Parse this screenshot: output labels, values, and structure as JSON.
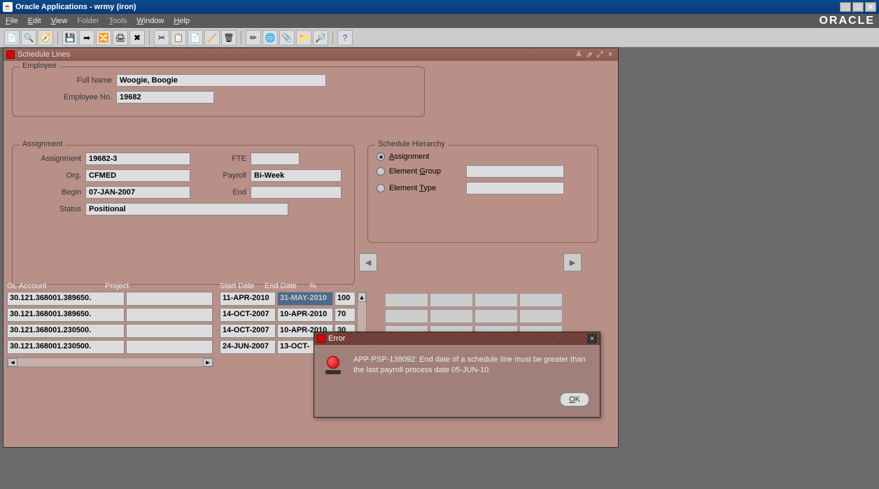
{
  "titlebar": {
    "text": "Oracle Applications - wrmy (iron)"
  },
  "menu": {
    "file": "File",
    "edit": "Edit",
    "view": "View",
    "folder": "Folder",
    "tools": "Tools",
    "window": "Window",
    "help": "Help"
  },
  "brand": "ORACLE",
  "intwin": {
    "title": "Schedule Lines"
  },
  "employee": {
    "legend": "Employee",
    "full_name_lbl": "Full Name",
    "full_name": "Woogie, Boogie",
    "emp_no_lbl": "Employee No.",
    "emp_no": "19682"
  },
  "assignment": {
    "legend": "Assignment",
    "assignment_lbl": "Assignment",
    "assignment": "19682-3",
    "fte_lbl": "FTE",
    "fte": "",
    "org_lbl": "Org.",
    "org": "CFMED",
    "payroll_lbl": "Payroll",
    "payroll": "Bi-Week",
    "begin_lbl": "Begin",
    "begin": "07-JAN-2007",
    "end_lbl": "End",
    "end": "",
    "status_lbl": "Status",
    "status": "Positional"
  },
  "hierarchy": {
    "legend": "Schedule Hierarchy",
    "assignment": "Assignment",
    "element_group": "Element Group",
    "element_type": "Element Type"
  },
  "grid": {
    "headers": {
      "gl": "GL Account",
      "project": "Project",
      "start": "Start Date",
      "end": "End Date",
      "pct": "%"
    },
    "rows": [
      {
        "gl": "30.121.368001.389650.",
        "project": "",
        "start": "11-APR-2010",
        "end": "31-MAY-2010",
        "pct": "100",
        "highlight": true
      },
      {
        "gl": "30.121.368001.389650.",
        "project": "",
        "start": "14-OCT-2007",
        "end": "10-APR-2010",
        "pct": "70",
        "highlight": false
      },
      {
        "gl": "30.121.368001.230500.",
        "project": "",
        "start": "14-OCT-2007",
        "end": "10-APR-2010",
        "pct": "30",
        "highlight": false
      },
      {
        "gl": "30.121.368001.230500.",
        "project": "",
        "start": "24-JUN-2007",
        "end": "13-OCT-",
        "pct": "",
        "highlight": false
      }
    ]
  },
  "modal": {
    "title": "Error",
    "message": "APP-PSP-138092: End date of a schedule line must be greater than the last payroll process date 05-JUN-10.",
    "ok": "OK"
  }
}
